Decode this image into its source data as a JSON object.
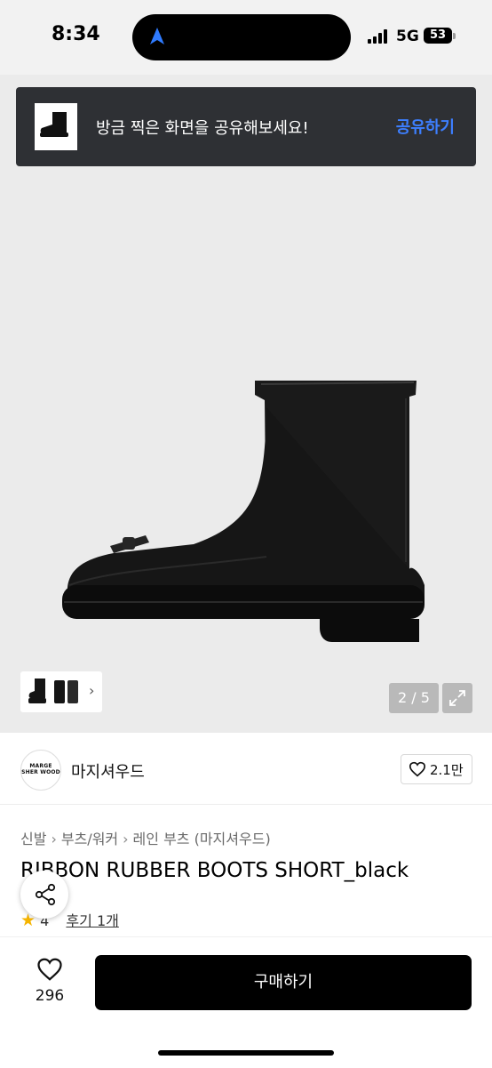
{
  "status_bar": {
    "time": "8:34",
    "network": "5G",
    "battery": "53"
  },
  "share_banner": {
    "message": "방금 찍은 화면을 공유해보세요!",
    "action": "공유하기"
  },
  "gallery": {
    "counter": "2 / 5"
  },
  "brand": {
    "logo_text": "MARGE SHER WOOD",
    "name": "마지셔우드",
    "likes": "2.1만"
  },
  "breadcrumb": [
    "신발",
    "부츠/워커",
    "레인 부츠 (마지셔우드)"
  ],
  "product": {
    "title": "RIBBON RUBBER BOOTS SHORT_black",
    "rating": "4",
    "reviews": "후기 1개"
  },
  "bottom_bar": {
    "wish_count": "296",
    "buy_label": "구매하기"
  },
  "colors": {
    "accent": "#3d7fff",
    "banner_bg": "#2e3034",
    "gallery_bg": "#ebebeb",
    "primary_button": "#000000"
  },
  "icons": [
    "navigation-arrow-icon",
    "signal-icon",
    "battery-icon",
    "chevron-right-icon",
    "expand-icon",
    "heart-icon",
    "star-icon",
    "share-icon"
  ]
}
